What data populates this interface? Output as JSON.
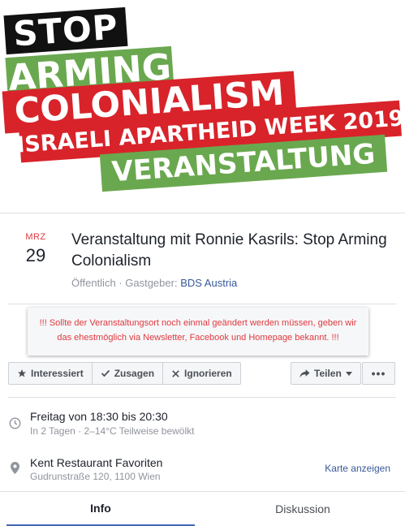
{
  "banner": {
    "line1": "STOP",
    "line2": "ARMING",
    "line3": "COLONIALISM",
    "line4": "ISRAELI APARTHEID WEEK 2019",
    "line5": "VERANSTALTUNG"
  },
  "event": {
    "month": "MRZ",
    "day": "29",
    "title": "Veranstaltung mit Ronnie Kasrils: Stop Arming Colonialism",
    "visibility": "Öffentlich",
    "separator": " · ",
    "host_label": "Gastgeber: ",
    "host": "BDS Austria"
  },
  "notice": "!!! Sollte der Veranstaltungsort noch einmal geändert werden müssen, geben wir das ehestmöglich via Newsletter, Facebook und Homepage bekannt. !!!",
  "actions": {
    "interested": "Interessiert",
    "going": "Zusagen",
    "ignore": "Ignorieren",
    "share": "Teilen",
    "more": "•••"
  },
  "time": {
    "main": "Freitag von 18:30 bis 20:30",
    "sub": "In 2 Tagen · 2–14°C Teilweise bewölkt"
  },
  "location": {
    "name": "Kent Restaurant Favoriten",
    "address": "Gudrunstraße 120, 1100 Wien",
    "map_link": "Karte anzeigen"
  },
  "tabs": {
    "info": "Info",
    "discussion": "Diskussion"
  },
  "colors": {
    "red": "#d8232a",
    "green": "#6aa84f",
    "link": "#385898"
  }
}
